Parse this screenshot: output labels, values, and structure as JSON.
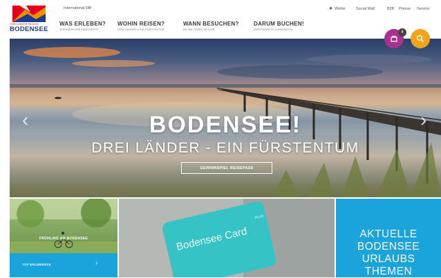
{
  "brand": {
    "logo_small": "VIER LÄNDER REGION",
    "logo_text": "BODENSEE"
  },
  "header": {
    "international": "International DE",
    "international_plus": "+",
    "utility": {
      "weather": "Wetter",
      "social_wall": "Social Wall",
      "b2b": "B2B",
      "press": "Presse",
      "service": "Service"
    },
    "nav": [
      {
        "title": "WAS ERLEBEN?",
        "sub": "GRENZENLOSE ABENTEUER"
      },
      {
        "title": "WOHIN REISEN?",
        "sub": "DREI LÄNDER & EIN FÜRSTENTUM"
      },
      {
        "title": "WANN BESUCHEN?",
        "sub": "AN 365 TAGEN IM JAHR"
      },
      {
        "title": "DARUM BUCHEN!",
        "sub": "UNTERKÜNFTE & ANGEBOTE"
      }
    ],
    "favorites_count": "4"
  },
  "hero": {
    "title": "BODENSEE!",
    "subtitle": "DREI LÄNDER - EIN FÜRSTENTUM",
    "cta": "GEWINNSPIEL REISEPASS",
    "prev_arrow": "‹",
    "next_arrow": "›"
  },
  "tiles": {
    "spring_label": "FRÜHLING AM BODENSEE",
    "top_label": "TOP ERLEBNISSE",
    "top_arrow": "›",
    "card_text": "Bodensee Card",
    "card_plus": "PLUS",
    "topics_line1": "AKTUELLE",
    "topics_line2": "BODENSEE",
    "topics_line3": "URLAUBS",
    "topics_line4": "THEMEN"
  },
  "colors": {
    "brand_blue": "#1a3c8c",
    "brand_red": "#e2001a",
    "accent_purple": "#a8328d",
    "accent_orange": "#f0a51a",
    "tile_blue": "#1ba3dc"
  }
}
